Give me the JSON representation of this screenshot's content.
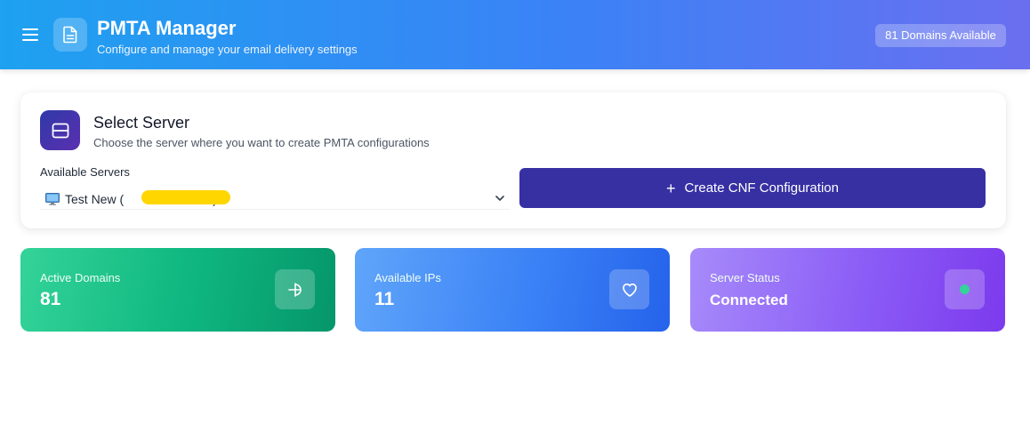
{
  "header": {
    "title": "PMTA Manager",
    "subtitle": "Configure and manage your email delivery settings",
    "badge": "81 Domains Available",
    "logo_icon": "document-icon",
    "menu_icon": "hamburger-menu-icon"
  },
  "server_card": {
    "title": "Select Server",
    "subtitle": "Choose the server where you want to create PMTA configurations",
    "icon": "server-icon",
    "field_label": "Available Servers",
    "selected_server": "Test New (",
    "selected_server_suffix": ")",
    "create_button": "Create CNF Configuration"
  },
  "stats": [
    {
      "label": "Active Domains",
      "value": "81",
      "icon": "domain-icon",
      "color": "#10b981"
    },
    {
      "label": "Available IPs",
      "value": "11",
      "icon": "heart-icon",
      "color": "#3b82f6"
    },
    {
      "label": "Server Status",
      "value": "Connected",
      "icon": "status-dot-icon",
      "color": "#8b5cf6"
    }
  ],
  "colors": {
    "primary_button": "#3730a3",
    "status_dot": "#34d399"
  }
}
